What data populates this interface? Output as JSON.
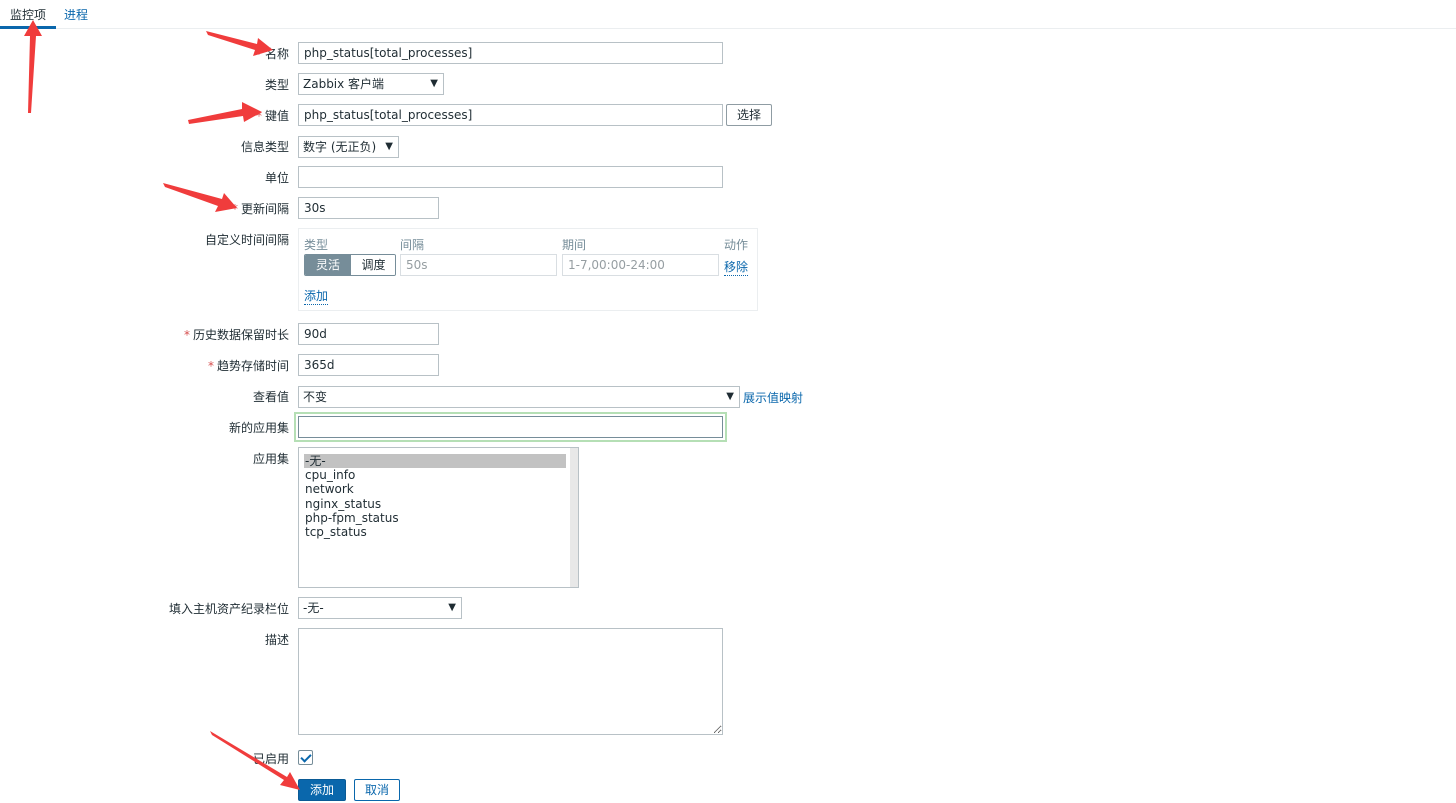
{
  "tabs": {
    "active": "监控项",
    "other": "进程"
  },
  "form": {
    "name": {
      "label": "名称",
      "value": "php_status[total_processes]"
    },
    "type": {
      "label": "类型",
      "value": "Zabbix 客户端"
    },
    "key": {
      "label": "键值",
      "value": "php_status[total_processes]",
      "select_button": "选择"
    },
    "info_type": {
      "label": "信息类型",
      "value": "数字 (无正负)"
    },
    "unit": {
      "label": "单位",
      "value": ""
    },
    "update_interval": {
      "label": "更新间隔",
      "value": "30s"
    },
    "custom_intervals": {
      "label": "自定义时间间隔",
      "col_type": "类型",
      "col_interval": "间隔",
      "col_period": "期间",
      "col_action": "动作",
      "seg_flexible": "灵活",
      "seg_scheduling": "调度",
      "interval_placeholder": "50s",
      "period_placeholder": "1-7,00:00-24:00",
      "remove": "移除",
      "add": "添加"
    },
    "history": {
      "label": "历史数据保留时长",
      "value": "90d"
    },
    "trends": {
      "label": "趋势存储时间",
      "value": "365d"
    },
    "value_map": {
      "label": "查看值",
      "value": "不变",
      "link": "展示值映射"
    },
    "new_application": {
      "label": "新的应用集",
      "value": ""
    },
    "applications": {
      "label": "应用集",
      "options": [
        "-无-",
        "cpu_info",
        "network",
        "nginx_status",
        "php-fpm_status",
        "tcp_status"
      ]
    },
    "inventory": {
      "label": "填入主机资产纪录栏位",
      "value": "-无-"
    },
    "description": {
      "label": "描述",
      "value": ""
    },
    "enabled": {
      "label": "已启用"
    },
    "add_button": "添加",
    "cancel_button": "取消"
  },
  "required_mark": "*",
  "colors": {
    "accent": "#0a67ac",
    "annotation_arrow": "#f03c3c",
    "focus_border": "#b5dfb5"
  }
}
